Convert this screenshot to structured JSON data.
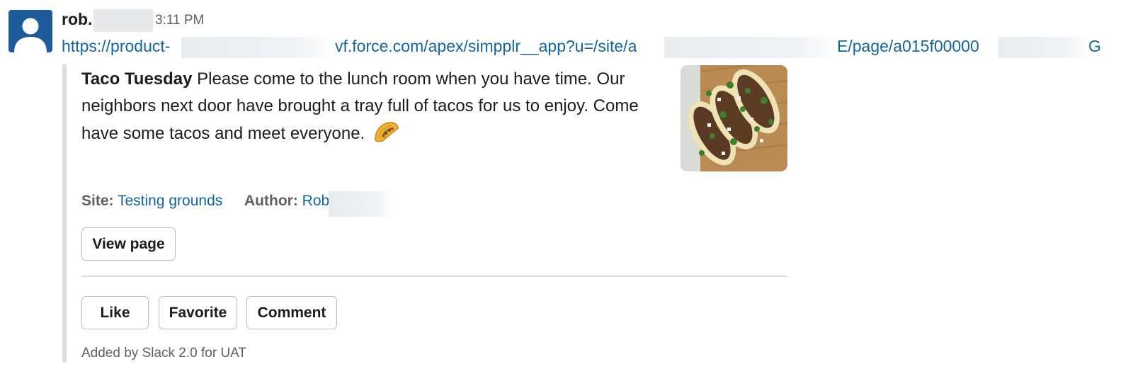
{
  "message": {
    "username": "rob.",
    "timestamp": "3:11 PM",
    "avatar_icon": "user-silhouette-icon",
    "link": {
      "part1": "https://product-",
      "part2": "vf.force.com/apex/simpplr__app?u=/site/",
      "part2_tail": "a",
      "part3": "E/page/a015f00000",
      "part4": "G"
    }
  },
  "attachment": {
    "title": "Taco Tuesday",
    "body": "Please come to the lunch room when you have time. Our neighbors next door have brought a tray full of tacos for us to enjoy. Come have some tacos and meet everyone.",
    "emoji_icon": "taco-emoji-icon",
    "thumbnail_icon": "taco-photo",
    "site_label": "Site:",
    "site_value": "Testing grounds",
    "author_label": "Author:",
    "author_value": "Rob",
    "view_page_label": "View page",
    "actions": {
      "like": "Like",
      "favorite": "Favorite",
      "comment": "Comment"
    },
    "footer": "Added by Slack 2.0 for UAT"
  },
  "colors": {
    "link": "#1264a3",
    "text": "#1d1c1d",
    "muted": "#616061",
    "avatar_bg": "#1d5b9a",
    "quote_bar": "#dddddd"
  }
}
